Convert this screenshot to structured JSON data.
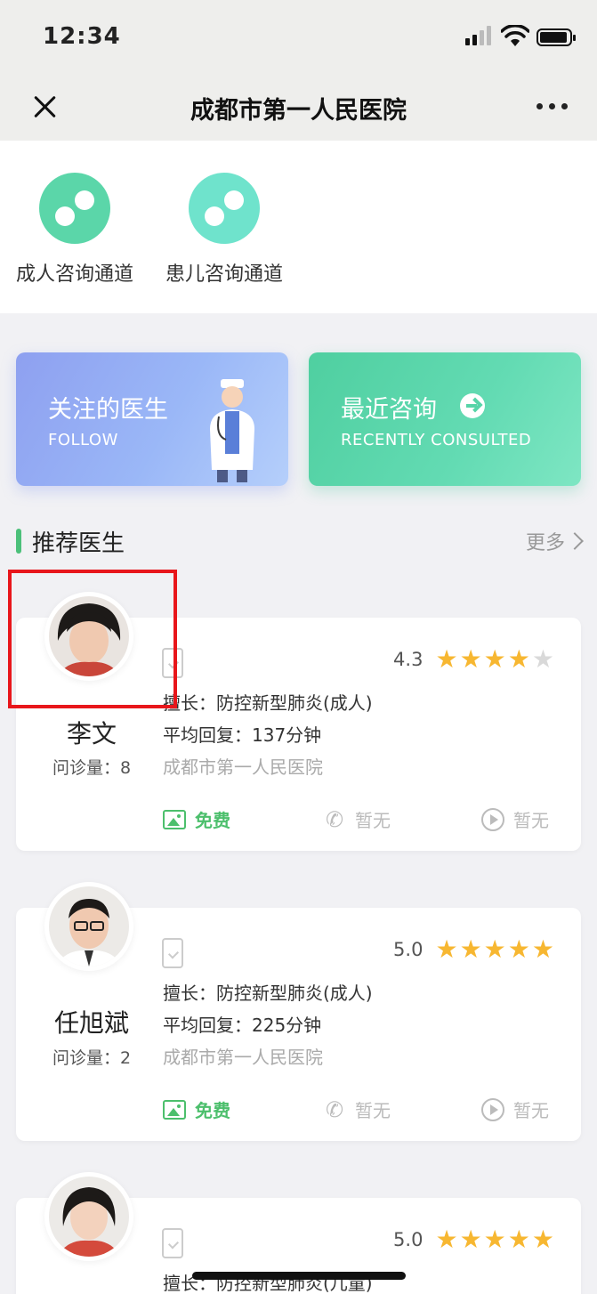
{
  "status_bar": {
    "time": "12:34"
  },
  "navbar": {
    "title": "成都市第一人民医院"
  },
  "channels": [
    {
      "label": "成人咨询通道",
      "color": "#5bd6a9"
    },
    {
      "label": "患儿咨询通道",
      "color": "#6fe3cc"
    }
  ],
  "banners": {
    "follow": {
      "title": "关注的医生",
      "subtitle": "FOLLOW"
    },
    "recent": {
      "title": "最近咨询",
      "subtitle": "RECENTLY CONSULTED"
    }
  },
  "section": {
    "title": "推荐医生",
    "more": "更多"
  },
  "doctors": [
    {
      "name": "李文",
      "count_label": "问诊量：8",
      "rating": "4.3",
      "stars": 4,
      "specialty": "擅长：防控新型肺炎(成人)",
      "avg_reply": "平均回复：137分钟",
      "hospital": "成都市第一人民医院",
      "services": {
        "image": "免费",
        "phone": "暂无",
        "video": "暂无"
      }
    },
    {
      "name": "任旭斌",
      "count_label": "问诊量：2",
      "rating": "5.0",
      "stars": 5,
      "specialty": "擅长：防控新型肺炎(成人)",
      "avg_reply": "平均回复：225分钟",
      "hospital": "成都市第一人民医院",
      "services": {
        "image": "免费",
        "phone": "暂无",
        "video": "暂无"
      }
    },
    {
      "name": "",
      "count_label": "",
      "rating": "5.0",
      "stars": 5,
      "specialty": "擅长：防控新型肺炎(儿童)",
      "avg_reply": "",
      "hospital": "",
      "services": {
        "image": "",
        "phone": "",
        "video": ""
      }
    }
  ],
  "colors": {
    "accent_green": "#4cbf6c",
    "star": "#f7b731",
    "highlight": "#e8161b"
  }
}
